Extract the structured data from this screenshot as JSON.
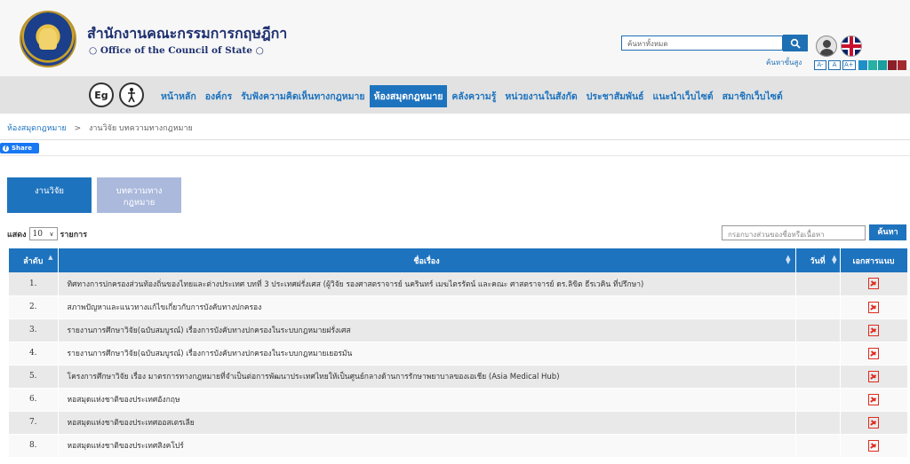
{
  "header": {
    "site_name_th": "สำนักงานคณะกรรมการกฤษฎีกา",
    "site_name_en": "Office of the Council of State",
    "search_placeholder": "ค้นหาทั้งหมด",
    "advanced_search": "ค้นหาขั้นสูง",
    "font_sizes": [
      "A-",
      "A",
      "A+"
    ],
    "theme_colors": [
      "#1e8ec7",
      "#26b0a6",
      "#1b9e9e",
      "#8a1f2a",
      "#a3282e"
    ]
  },
  "nav": {
    "items": [
      "หน้าหลัก",
      "องค์กร",
      "รับฟังความคิดเห็นทางกฎหมาย",
      "ห้องสมุดกฎหมาย",
      "คลังความรู้",
      "หน่วยงานในสังกัด",
      "ประชาสัมพันธ์",
      "แนะนำเว็บไซต์",
      "สมาชิกเว็บไซต์"
    ],
    "active_index": 3
  },
  "breadcrumb": {
    "items": [
      "ห้องสมุดกฎหมาย",
      "งานวิจัย บทความทางกฎหมาย"
    ],
    "separator": ">"
  },
  "share": {
    "label": "Share"
  },
  "tabs": [
    {
      "label": "งานวิจัย",
      "active": true
    },
    {
      "label": "บทความทาง กฎหมาย",
      "active": false
    }
  ],
  "list_controls": {
    "show_label": "แสดง",
    "length_value": "10",
    "entries_label": "รายการ",
    "filter_placeholder": "กรอกบางส่วนของชื่อหรือเนื้อหา",
    "filter_button": "ค้นหา"
  },
  "table": {
    "columns": [
      "ลำดับ",
      "ชื่อเรื่อง",
      "วันที่",
      "เอกสารแนบ"
    ],
    "rows": [
      {
        "no": "1.",
        "title": "ทิศทางการปกครองส่วนท้องถิ่นของไทยและต่างประเทศ บทที่ 3 ประเทศฝรั่งเศส (ผู้วิจัย รองศาสตราจารย์ นครินทร์ เมฆไตรรัตน์ และคณะ ศาสตราจารย์ ดร.ลิขิต ธีรเวคิน ที่ปรึกษา)",
        "date": ""
      },
      {
        "no": "2.",
        "title": "สภาพปัญหาและแนวทางแก้ไขเกี่ยวกับการบังคับทางปกครอง",
        "date": ""
      },
      {
        "no": "3.",
        "title": "รายงานการศึกษาวิจัย(ฉบับสมบูรณ์) เรื่องการบังคับทางปกครองในระบบกฎหมายฝรั่งเศส",
        "date": ""
      },
      {
        "no": "4.",
        "title": "รายงานการศึกษาวิจัย(ฉบับสมบูรณ์) เรื่องการบังคับทางปกครองในระบบกฎหมายเยอรมัน",
        "date": ""
      },
      {
        "no": "5.",
        "title": "โครงการศึกษาวิจัย เรื่อง มาตรการทางกฎหมายที่จำเป็นต่อการพัฒนาประเทศไทยให้เป็นศูนย์กลางด้านการรักษาพยาบาลของเอเชีย (Asia Medical Hub)",
        "date": ""
      },
      {
        "no": "6.",
        "title": "หอสมุดแห่งชาติของประเทศอังกฤษ",
        "date": ""
      },
      {
        "no": "7.",
        "title": "หอสมุดแห่งชาติของประเทศออสเตรเลีย",
        "date": ""
      },
      {
        "no": "8.",
        "title": "หอสมุดแห่งชาติของประเทศสิงคโปร์",
        "date": ""
      }
    ]
  }
}
